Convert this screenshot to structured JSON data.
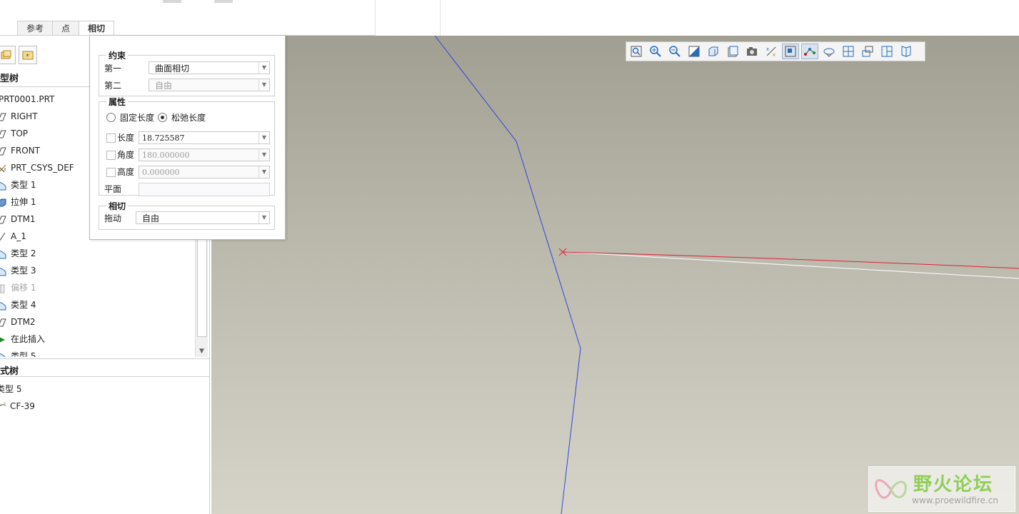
{
  "tabs": [
    "参考",
    "点",
    "相切"
  ],
  "left_panel": {
    "model_tree_title": "型树",
    "feature_tree_title": "式树",
    "tree_items": [
      {
        "label": "PRT0001.PRT",
        "icon": "part-icon"
      },
      {
        "label": "RIGHT",
        "icon": "datum-plane-icon"
      },
      {
        "label": "TOP",
        "icon": "datum-plane-icon"
      },
      {
        "label": "FRONT",
        "icon": "datum-plane-icon"
      },
      {
        "label": "PRT_CSYS_DEF",
        "icon": "coordinate-system-icon"
      },
      {
        "label": "类型 1",
        "icon": "style-feature-icon"
      },
      {
        "label": "拉伸 1",
        "icon": "extrude-icon"
      },
      {
        "label": "DTM1",
        "icon": "datum-plane-icon"
      },
      {
        "label": "A_1",
        "icon": "datum-axis-icon"
      },
      {
        "label": "类型 2",
        "icon": "style-feature-icon"
      },
      {
        "label": "类型 3",
        "icon": "style-feature-icon"
      },
      {
        "label": "偏移 1",
        "icon": "offset-icon",
        "dim": true
      },
      {
        "label": "类型 4",
        "icon": "style-feature-icon"
      },
      {
        "label": "DTM2",
        "icon": "datum-plane-icon"
      },
      {
        "label": "在此插入",
        "icon": "insert-here-icon"
      },
      {
        "label": "类型 5",
        "icon": "style-feature-icon"
      }
    ],
    "style_tree_items": [
      {
        "label": "类型 5",
        "icon": ""
      },
      {
        "label": "CF-39",
        "icon": "curve-icon"
      }
    ]
  },
  "tangent_panel": {
    "constraint_group": "约束",
    "first_label": "第一",
    "first_value": "曲面相切",
    "second_label": "第二",
    "second_value": "自由",
    "property_group": "属性",
    "fixed_length": "固定长度",
    "relaxed_length": "松弛长度",
    "length_label": "长度",
    "length_value": "18.725587",
    "angle_label": "角度",
    "angle_value": "180.000000",
    "height_label": "高度",
    "height_value": "0.000000",
    "plane_label": "平面",
    "tangent_group": "相切",
    "drag_label": "拖动",
    "drag_value": "自由"
  },
  "watermark": {
    "text": "野火论坛",
    "url": "www.proewildfire.cn"
  },
  "colors": {
    "curve_blue": "#2d45e0",
    "curve_red": "#e0203a",
    "viewport_top": "#a19f92",
    "viewport_bottom": "#d6d4c9"
  }
}
